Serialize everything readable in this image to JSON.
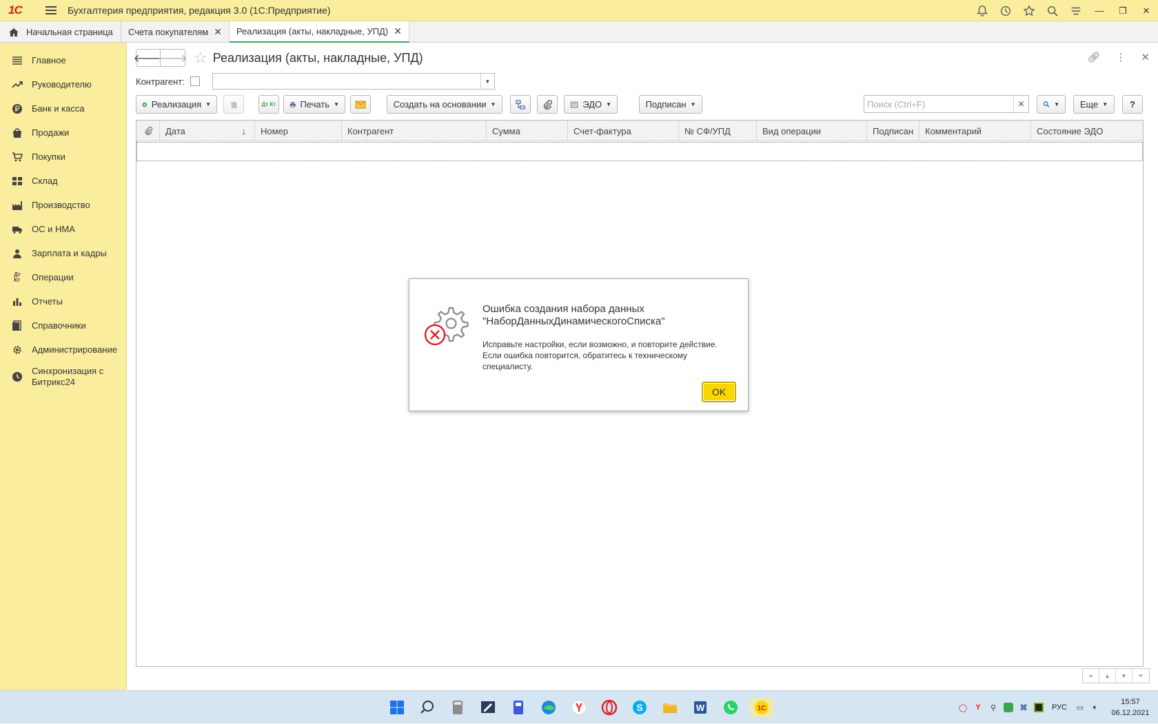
{
  "app": {
    "logo_text": "1С",
    "title": "Бухгалтерия предприятия, редакция 3.0  (1С:Предприятие)"
  },
  "tabs": [
    {
      "label": "Начальная страница"
    },
    {
      "label": "Счета покупателям"
    },
    {
      "label": "Реализация (акты, накладные, УПД)"
    }
  ],
  "sidebar": {
    "items": [
      {
        "label": "Главное",
        "icon": "list-icon"
      },
      {
        "label": "Руководителю",
        "icon": "trend-icon"
      },
      {
        "label": "Банк и касса",
        "icon": "ruble-icon"
      },
      {
        "label": "Продажи",
        "icon": "bag-icon"
      },
      {
        "label": "Покупки",
        "icon": "cart-icon"
      },
      {
        "label": "Склад",
        "icon": "warehouse-icon"
      },
      {
        "label": "Производство",
        "icon": "factory-icon"
      },
      {
        "label": "ОС и НМА",
        "icon": "truck-icon"
      },
      {
        "label": "Зарплата и кадры",
        "icon": "person-icon"
      },
      {
        "label": "Операции",
        "icon": "dt-kt-icon"
      },
      {
        "label": "Отчеты",
        "icon": "bar-chart-icon"
      },
      {
        "label": "Справочники",
        "icon": "books-icon"
      },
      {
        "label": "Администрирование",
        "icon": "gear-icon"
      },
      {
        "label": "Синхронизация с Битрикс24",
        "icon": "bitrix-icon"
      }
    ]
  },
  "page": {
    "title": "Реализация (акты, накладные, УПД)",
    "filter_label": "Контрагент:",
    "filter_value": ""
  },
  "toolbar": {
    "create_label": "Реализация",
    "dt_kt_label": "Дт Кт",
    "print_label": "Печать",
    "create_based_label": "Создать на основании",
    "edo_label": "ЭДО",
    "signed_label": "Подписан",
    "search_placeholder": "Поиск (Ctrl+F)",
    "more_label": "Еще",
    "help_label": "?"
  },
  "table": {
    "columns": [
      "Дата",
      "Номер",
      "Контрагент",
      "Сумма",
      "Счет-фактура",
      "№ СФ/УПД",
      "Вид операции",
      "Подписан",
      "Комментарий",
      "Состояние ЭДО"
    ],
    "sort_indicator": "↓"
  },
  "dialog": {
    "title": "Ошибка создания набора данных \"НаборДанныхДинамическогоСписка\"",
    "text": "Исправьте настройки, если возможно, и повторите действие. Если ошибка повторится, обратитесь к техническому специалисту.",
    "ok_label": "OK"
  },
  "taskbar": {
    "lang": "РУС",
    "time": "15:57",
    "date": "06.12.2021"
  },
  "colors": {
    "brand_yellow": "#fbed9e",
    "ok_yellow": "#f8d700",
    "error_red": "#e0212a",
    "active_tab_line": "#3ba55c"
  }
}
